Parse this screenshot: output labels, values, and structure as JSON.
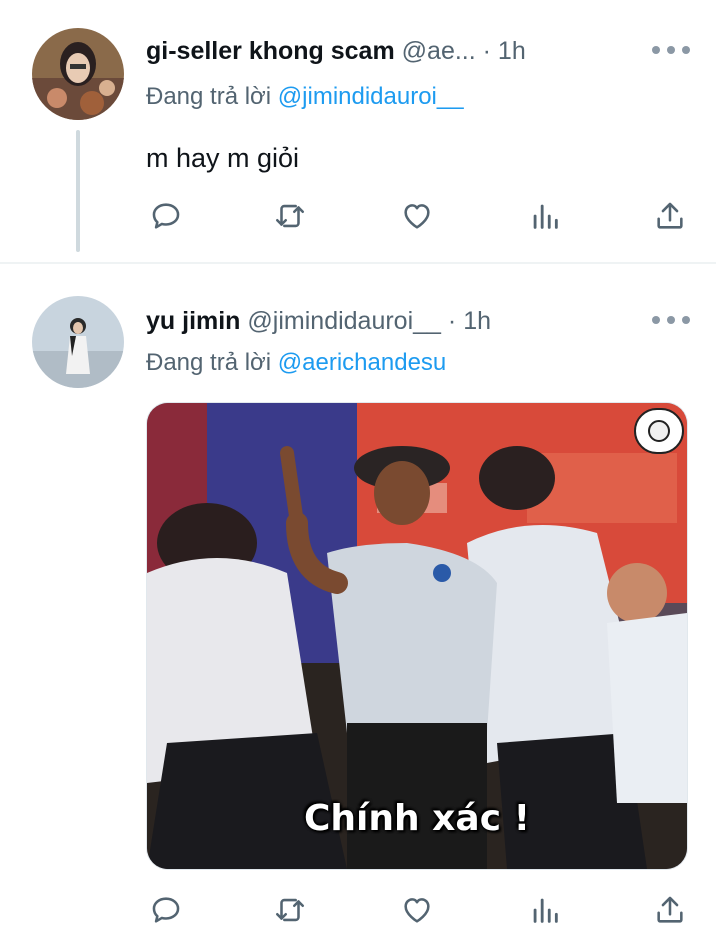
{
  "tweets": [
    {
      "display_name": "gi-seller khong scam",
      "handle": "@ae...",
      "separator": "·",
      "time": "1h",
      "reply_prefix": "Đang trả lời",
      "reply_to": "@jimindidauroi__",
      "text": "m hay m giỏi"
    },
    {
      "display_name": "yu jimin",
      "handle": "@jimindidauroi__",
      "separator": "·",
      "time": "1h",
      "reply_prefix": "Đang trả lời",
      "reply_to": "@aerichandesu",
      "media_caption": "Chính xác !"
    }
  ],
  "actions": [
    "reply-icon",
    "retweet-icon",
    "like-icon",
    "analytics-icon",
    "share-icon"
  ],
  "colors": {
    "link": "#1d9bf0",
    "secondary_text": "#536471",
    "icon": "#536471",
    "divider": "#eff3f4"
  }
}
